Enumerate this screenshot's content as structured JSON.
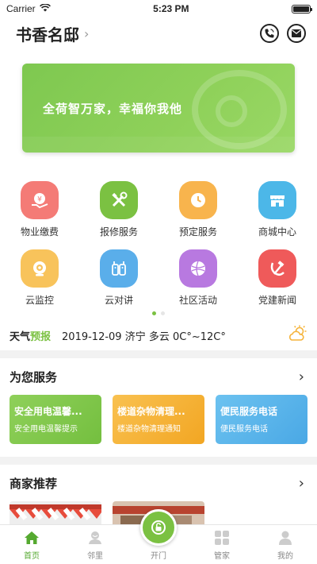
{
  "status": {
    "carrier": "Carrier",
    "time": "5:23 PM"
  },
  "header": {
    "title": "书香名邸"
  },
  "banner": {
    "slogan": "全荷智万家，幸福你我他"
  },
  "grid": [
    {
      "label": "物业缴费",
      "color": "#f47b76",
      "icon": "property-fee-icon"
    },
    {
      "label": "报修服务",
      "color": "#7bc142",
      "icon": "repair-tools-icon"
    },
    {
      "label": "预定服务",
      "color": "#f8b44d",
      "icon": "clock-icon"
    },
    {
      "label": "商城中心",
      "color": "#4cb7e8",
      "icon": "store-icon"
    },
    {
      "label": "云监控",
      "color": "#f8c35b",
      "icon": "camera-icon"
    },
    {
      "label": "云对讲",
      "color": "#5aaeea",
      "icon": "walkie-talkie-icon"
    },
    {
      "label": "社区活动",
      "color": "#b879e0",
      "icon": "ball-icon"
    },
    {
      "label": "党建新闻",
      "color": "#ef5a5a",
      "icon": "hammer-sickle-icon"
    }
  ],
  "weather": {
    "brand_a": "天气",
    "brand_b": "预报",
    "text": "2019-12-09 济宁 多云 0C°~12C°"
  },
  "services_section": {
    "title": "为您服务"
  },
  "services": [
    {
      "title": "安全用电温馨...",
      "subtitle": "安全用电温馨提示",
      "color": "#82c94e"
    },
    {
      "title": "楼道杂物清理...",
      "subtitle": "楼道杂物清理通知",
      "color": "#f6b53a"
    },
    {
      "title": "便民服务电话",
      "subtitle": "便民服务电话",
      "color": "#5cb5ec"
    }
  ],
  "merchants_section": {
    "title": "商家推荐"
  },
  "tabs": [
    {
      "label": "首页",
      "active": true
    },
    {
      "label": "邻里",
      "active": false
    },
    {
      "label": "开门",
      "active": false
    },
    {
      "label": "管家",
      "active": false
    },
    {
      "label": "我的",
      "active": false
    }
  ],
  "colors": {
    "accent": "#7bc142"
  }
}
